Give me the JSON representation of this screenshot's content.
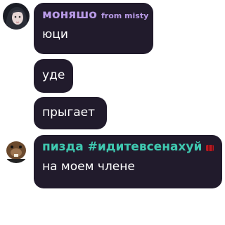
{
  "messages": [
    {
      "sender": "моняшо",
      "sender_sub": "from misty",
      "sender_color": "#b89ae6",
      "avatar_icon": "girl-portrait-avatar",
      "lines": [
        "юци",
        "уде",
        "прыгает"
      ]
    },
    {
      "sender": "пизда #идитевсенахуй",
      "sender_color": "#3fc9b0",
      "avatar_icon": "cartoon-beaver-avatar",
      "badge_color": "#b51a22",
      "lines": [
        "на моем члене"
      ]
    }
  ],
  "colors": {
    "bubble_bg": "#211b2c",
    "text": "#ffffff",
    "page_bg": "#ffffff"
  }
}
